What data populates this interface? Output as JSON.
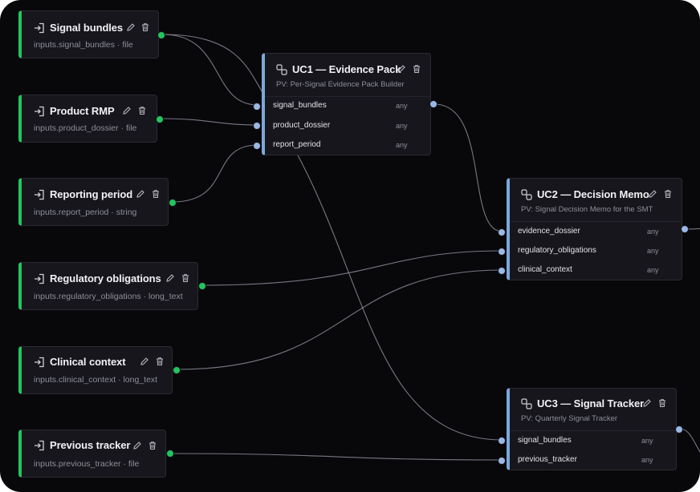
{
  "colors": {
    "background": "#08080b",
    "node": "#16161c",
    "input_accent": "#22c55e",
    "use_case_accent": "#7fa6d9",
    "wire": "#8a8d96"
  },
  "inputs": [
    {
      "title": "Signal bundles",
      "subtitle": "inputs.signal_bundles · file"
    },
    {
      "title": "Product RMP",
      "subtitle": "inputs.product_dossier · file"
    },
    {
      "title": "Reporting period",
      "subtitle": "inputs.report_period · string"
    },
    {
      "title": "Regulatory obligations",
      "subtitle": "inputs.regulatory_obligations · long_text"
    },
    {
      "title": "Clinical context",
      "subtitle": "inputs.clinical_context · long_text"
    },
    {
      "title": "Previous tracker",
      "subtitle": "inputs.previous_tracker · file"
    }
  ],
  "use_cases": [
    {
      "title": "UC1 — Evidence Pack",
      "subtitle": "PV: Per-Signal Evidence Pack Builder",
      "ports": [
        {
          "name": "signal_bundles",
          "type": "any"
        },
        {
          "name": "product_dossier",
          "type": "any"
        },
        {
          "name": "report_period",
          "type": "any"
        }
      ]
    },
    {
      "title": "UC2 — Decision Memo",
      "subtitle": "PV: Signal Decision Memo for the SMT",
      "ports": [
        {
          "name": "evidence_dossier",
          "type": "any"
        },
        {
          "name": "regulatory_obligations",
          "type": "any"
        },
        {
          "name": "clinical_context",
          "type": "any"
        }
      ]
    },
    {
      "title": "UC3 — Signal Tracker",
      "subtitle": "PV: Quarterly Signal Tracker",
      "ports": [
        {
          "name": "signal_bundles",
          "type": "any"
        },
        {
          "name": "previous_tracker",
          "type": "any"
        }
      ]
    }
  ],
  "icons": {
    "input": "arrow-into-box-icon",
    "use_case": "nodes-link-icon",
    "edit": "pencil-icon",
    "delete": "trash-icon"
  }
}
